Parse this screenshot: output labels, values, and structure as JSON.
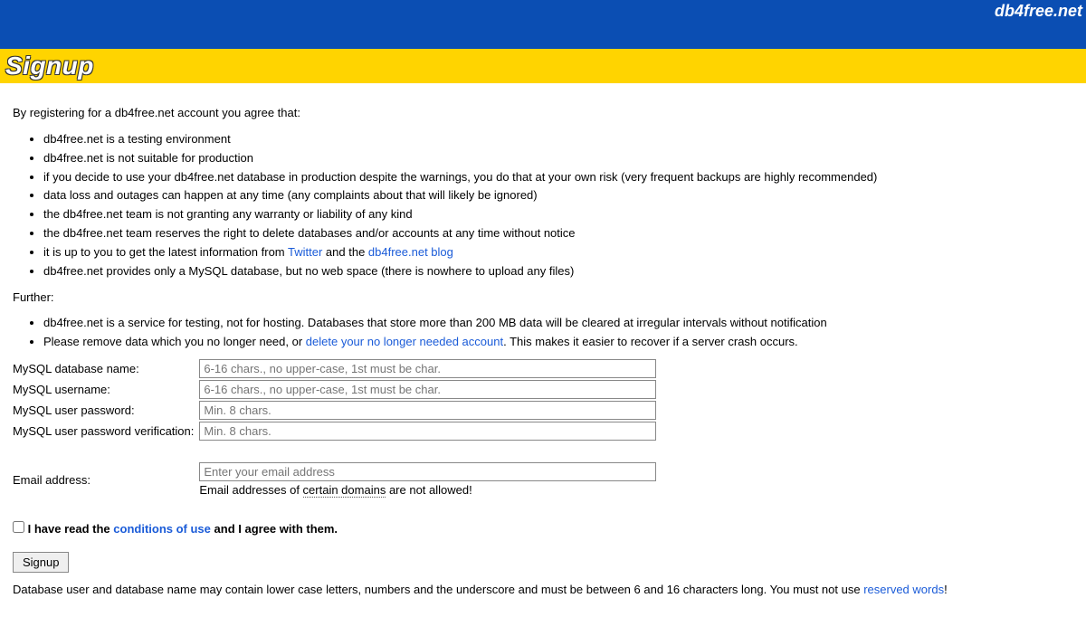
{
  "header": {
    "brand": "db4free.net",
    "title": "Signup"
  },
  "intro": "By registering for a db4free.net account you agree that:",
  "bullets1": [
    "db4free.net is a testing environment",
    "db4free.net is not suitable for production",
    "if you decide to use your db4free.net database in production despite the warnings, you do that at your own risk (very frequent backups are highly recommended)",
    "data loss and outages can happen at any time (any complaints about that will likely be ignored)",
    "the db4free.net team is not granting any warranty or liability of any kind",
    "the db4free.net team reserves the right to delete databases and/or accounts at any time without notice"
  ],
  "bullet_twitter": {
    "prefix": "it is up to you to get the latest information from ",
    "link1": "Twitter",
    "mid": " and the ",
    "link2": "db4free.net blog"
  },
  "bullet_last": "db4free.net provides only a MySQL database, but no web space (there is nowhere to upload any files)",
  "further_label": "Further:",
  "bullets2_first": "db4free.net is a service for testing, not for hosting. Databases that store more than 200 MB data will be cleared at irregular intervals without notification",
  "bullets2_second": {
    "prefix": "Please remove data which you no longer need, or ",
    "link": "delete your no longer needed account",
    "suffix": ". This makes it easier to recover if a server crash occurs."
  },
  "form": {
    "dbname_label": "MySQL database name:",
    "dbname_placeholder": "6-16 chars., no upper-case, 1st must be char.",
    "username_label": "MySQL username:",
    "username_placeholder": "6-16 chars., no upper-case, 1st must be char.",
    "password_label": "MySQL user password:",
    "password_placeholder": "Min. 8 chars.",
    "password2_label": "MySQL user password verification:",
    "password2_placeholder": "Min. 8 chars.",
    "email_label": "Email address:",
    "email_placeholder": "Enter your email address",
    "email_hint_prefix": "Email addresses of ",
    "email_hint_link": "certain domains",
    "email_hint_suffix": " are not allowed!"
  },
  "agree": {
    "prefix": "I have read the ",
    "link": "conditions of use",
    "suffix": " and I agree with them."
  },
  "button_label": "Signup",
  "footnote": {
    "text": "Database user and database name may contain lower case letters, numbers and the underscore and must be between 6 and 16 characters long. You must not use ",
    "link": "reserved words",
    "suffix": "!"
  }
}
